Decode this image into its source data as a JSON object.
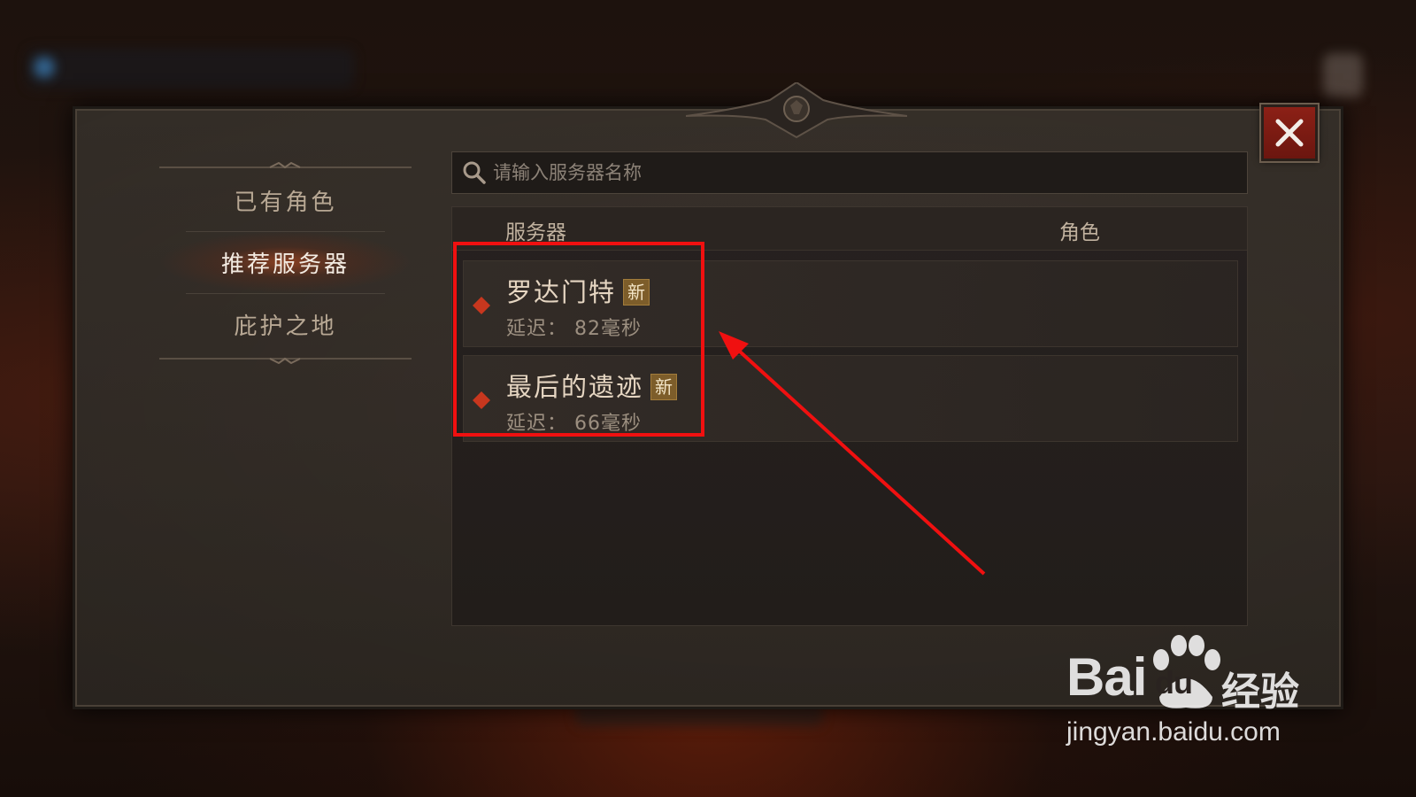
{
  "nav": {
    "items": [
      {
        "label": "已有角色",
        "active": false
      },
      {
        "label": "推荐服务器",
        "active": true
      },
      {
        "label": "庇护之地",
        "active": false
      }
    ]
  },
  "search": {
    "placeholder": "请输入服务器名称",
    "value": ""
  },
  "table": {
    "columns": {
      "server": "服务器",
      "role": "角色"
    },
    "rows": [
      {
        "name": "罗达门特",
        "badge": "新",
        "latency": "延迟：  82毫秒"
      },
      {
        "name": "最后的遗迹",
        "badge": "新",
        "latency": "延迟：  66毫秒"
      }
    ]
  },
  "colors": {
    "accent_red": "#f01010",
    "panel": "#362f29",
    "gem": "#c8371e",
    "badge_bg": "#7d5d2a"
  },
  "icons": {
    "close": "close-icon",
    "search": "search-icon",
    "server_status": "diamond-icon"
  },
  "watermark": {
    "brand": "Bai",
    "brand_du": "du",
    "product": "经验",
    "url": "jingyan.baidu.com"
  }
}
